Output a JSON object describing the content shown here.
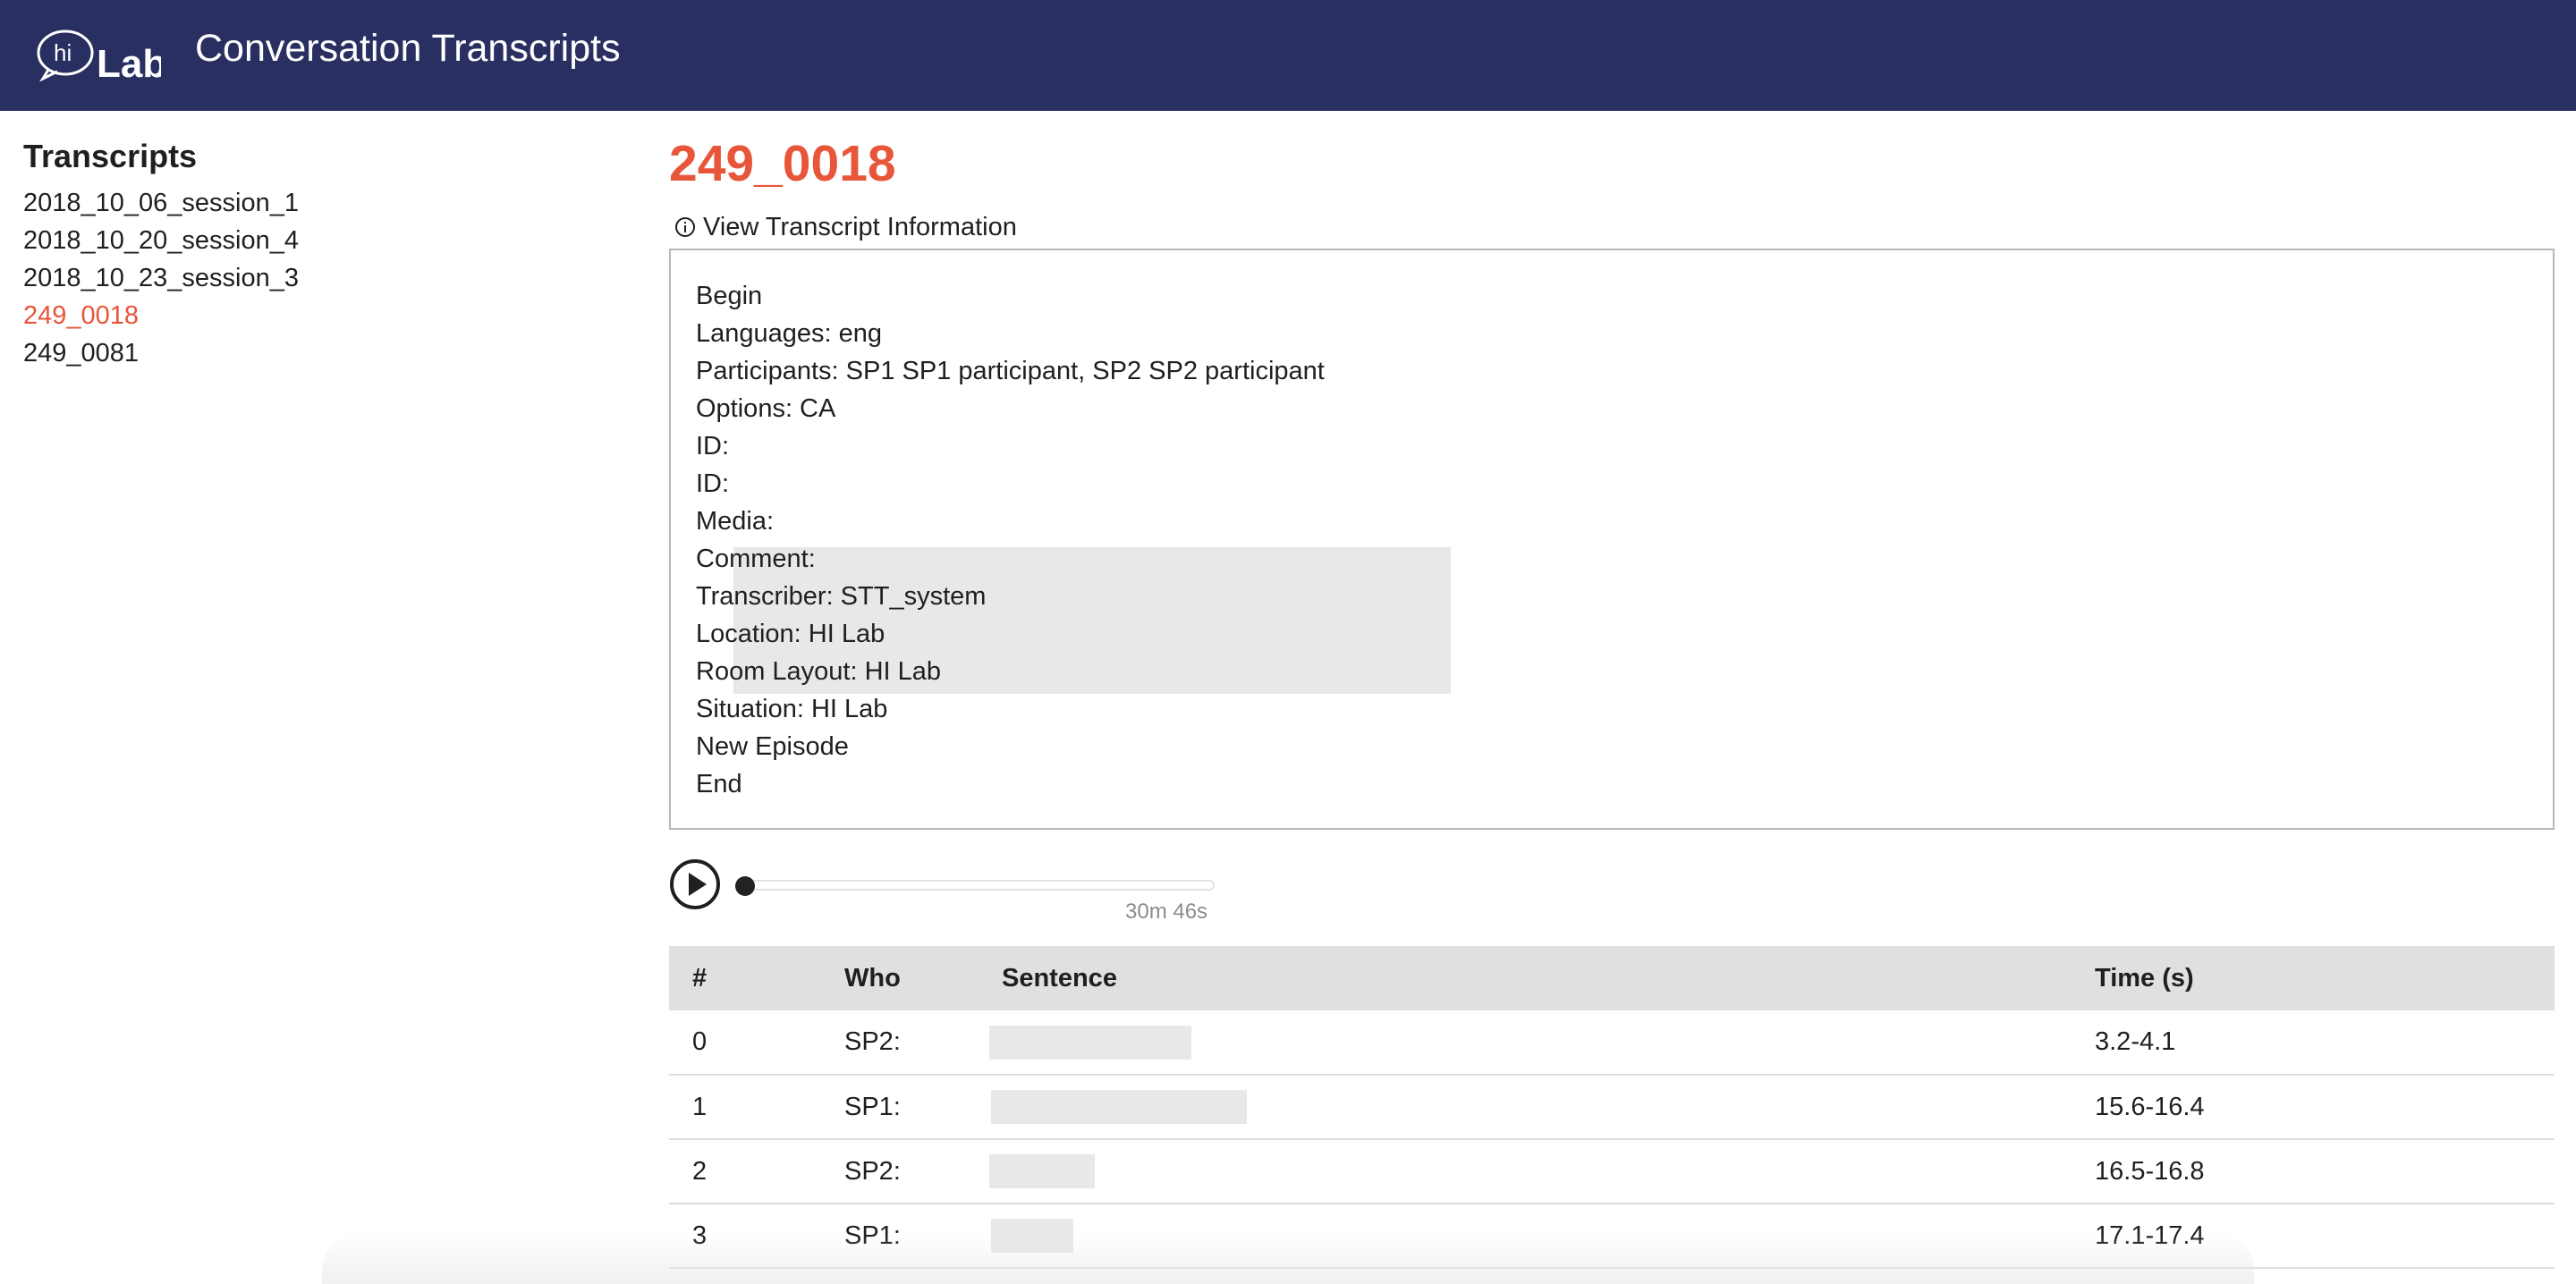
{
  "header": {
    "logo_text": "hi Lab",
    "title": "Conversation Transcripts",
    "background": "#2a2f62"
  },
  "sidebar": {
    "heading": "Transcripts",
    "items": [
      {
        "label": "2018_10_06_session_1",
        "active": false
      },
      {
        "label": "2018_10_20_session_4",
        "active": false
      },
      {
        "label": "2018_10_23_session_3",
        "active": false
      },
      {
        "label": "249_0018",
        "active": true
      },
      {
        "label": "249_0081",
        "active": false
      }
    ]
  },
  "main": {
    "title": "249_0018",
    "accent_color": "#e8563a",
    "info_toggle_label": "View Transcript Information",
    "info_toggle_icon": "info-circle-icon",
    "info_lines": [
      "Begin",
      "Languages: eng",
      "Participants: SP1 SP1 participant, SP2 SP2 participant",
      "Options: CA",
      "ID:",
      "ID:",
      "Media:",
      "Comment:",
      "Transcriber: STT_system",
      "Location: HI Lab",
      "Room Layout: HI Lab",
      "Situation: HI Lab",
      "New Episode",
      "End"
    ],
    "player": {
      "play_icon": "play-icon",
      "duration": "30m 46s",
      "progress": 0
    },
    "table": {
      "headers": [
        "#",
        "Who",
        "Sentence",
        "Time (s)"
      ],
      "rows": [
        {
          "num": "0",
          "who": "SP2:",
          "sentence": "",
          "time": "3.2-4.1"
        },
        {
          "num": "1",
          "who": "SP1:",
          "sentence": "",
          "time": "15.6-16.4"
        },
        {
          "num": "2",
          "who": "SP2:",
          "sentence": "",
          "time": "16.5-16.8"
        },
        {
          "num": "3",
          "who": "SP1:",
          "sentence": "",
          "time": "17.1-17.4"
        }
      ]
    }
  }
}
